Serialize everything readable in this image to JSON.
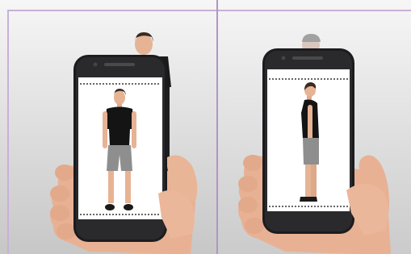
{
  "figure": {
    "panels": [
      {
        "view": "front"
      },
      {
        "view": "side"
      }
    ]
  },
  "colors": {
    "frame_border": "#b493c6",
    "phone_body": "#1c1c1e",
    "screen": "#ffffff",
    "backdrop_top": "#f4f4f4",
    "backdrop_bottom": "#c9c9c9",
    "skin": "#e9b596",
    "shirt": "#141414",
    "shorts": "#8e8e8e",
    "hair": "#3a2a22"
  }
}
